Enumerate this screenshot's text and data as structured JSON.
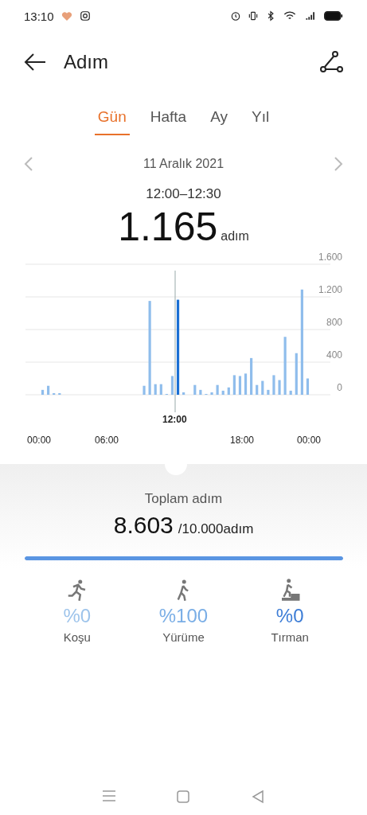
{
  "status_bar": {
    "time": "13:10"
  },
  "header": {
    "title": "Adım"
  },
  "tabs": [
    {
      "label": "Gün",
      "selected": true
    },
    {
      "label": "Hafta",
      "selected": false
    },
    {
      "label": "Ay",
      "selected": false
    },
    {
      "label": "Yıl",
      "selected": false
    }
  ],
  "date_nav": {
    "date": "11 Aralık 2021"
  },
  "selection": {
    "range": "12:00–12:30",
    "value": "1.165",
    "unit": "adım"
  },
  "chart": {
    "chart_data": {
      "type": "bar",
      "x": [
        0.25,
        0.75,
        1.25,
        1.75,
        2.25,
        2.75,
        3.25,
        3.75,
        4.25,
        4.75,
        5.25,
        5.75,
        6.25,
        6.75,
        7.25,
        7.75,
        8.25,
        8.75,
        9.25,
        9.75,
        10.25,
        10.75,
        11.25,
        11.75,
        12.25,
        12.75,
        13.25,
        13.75,
        14.25,
        14.75,
        15.25,
        15.75,
        16.25,
        16.75,
        17.25,
        17.75,
        18.25,
        18.75,
        19.25,
        19.75,
        20.25,
        20.75,
        21.25,
        21.75,
        22.25,
        22.75,
        23.25,
        23.75
      ],
      "series": [
        {
          "color": "#8fbdec",
          "values": [
            60,
            110,
            20,
            20,
            0,
            0,
            0,
            0,
            0,
            0,
            0,
            0,
            0,
            0,
            0,
            0,
            0,
            0,
            110,
            1150,
            130,
            130,
            10,
            230,
            null,
            30,
            0,
            120,
            60,
            10,
            30,
            120,
            50,
            90,
            240,
            230,
            260,
            450,
            120,
            170,
            60,
            240,
            180,
            710,
            50,
            510,
            1290,
            200
          ]
        },
        {
          "color": "#1a6fd4",
          "values": [
            null,
            null,
            null,
            null,
            null,
            null,
            null,
            null,
            null,
            null,
            null,
            null,
            null,
            null,
            null,
            null,
            null,
            null,
            null,
            null,
            null,
            null,
            null,
            null,
            1165,
            null,
            null,
            null,
            null,
            null,
            null,
            null,
            null,
            null,
            null,
            null,
            null,
            null,
            null,
            null,
            null,
            null,
            null,
            null,
            null,
            null,
            null,
            null
          ]
        }
      ],
      "xlim": [
        0,
        24
      ],
      "ylim": [
        0,
        1600
      ],
      "grid": true,
      "yticks": [
        0,
        400,
        800,
        {
          "value": 1200,
          "label": "1.200"
        },
        {
          "value": 1600,
          "label": "1.600"
        }
      ],
      "xticks": [
        {
          "value": 0,
          "label": "00:00"
        },
        {
          "value": 6,
          "label": "06:00"
        },
        {
          "value": 18,
          "label": "18:00"
        },
        {
          "value": 24,
          "label": "00:00"
        }
      ],
      "ref_lines": [
        {
          "axis": "x",
          "value": 12,
          "label": "12:00"
        }
      ]
    }
  },
  "summary": {
    "label": "Toplam adım",
    "value": "8.603",
    "goal": "/10.000adım",
    "level": 1
  },
  "activities": [
    {
      "kind": "run",
      "percent": "%0",
      "label": "Koşu",
      "color": "#9ec4eb"
    },
    {
      "kind": "walk",
      "percent": "%100",
      "label": "Yürüme",
      "color": "#7aaee6"
    },
    {
      "kind": "climb",
      "percent": "%0",
      "label": "Tırman",
      "color": "#3d7dd6"
    }
  ]
}
